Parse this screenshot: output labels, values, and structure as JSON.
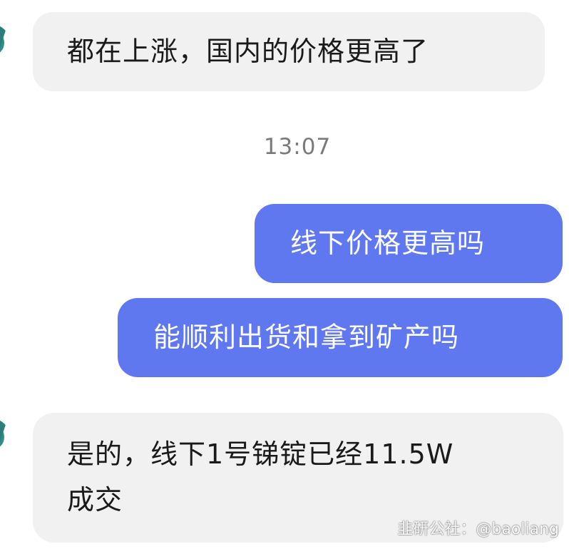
{
  "messages": [
    {
      "direction": "incoming",
      "text": "都在上涨，国内的价格更高了"
    },
    {
      "direction": "outgoing",
      "text": "线下价格更高吗"
    },
    {
      "direction": "outgoing",
      "text": "能顺利出货和拿到矿产吗"
    },
    {
      "direction": "incoming",
      "lines": [
        "是的，线下1号锑锭已经11.5W",
        "成交"
      ]
    }
  ],
  "timestamp": "13:07",
  "watermark": "韭研公社：@baoliang",
  "colors": {
    "incoming_bubble": "#f1f1f1",
    "outgoing_bubble": "#5f78f0",
    "avatar_accent": "#2f8d8a"
  },
  "icons": {
    "avatar": "contact-avatar-icon"
  }
}
